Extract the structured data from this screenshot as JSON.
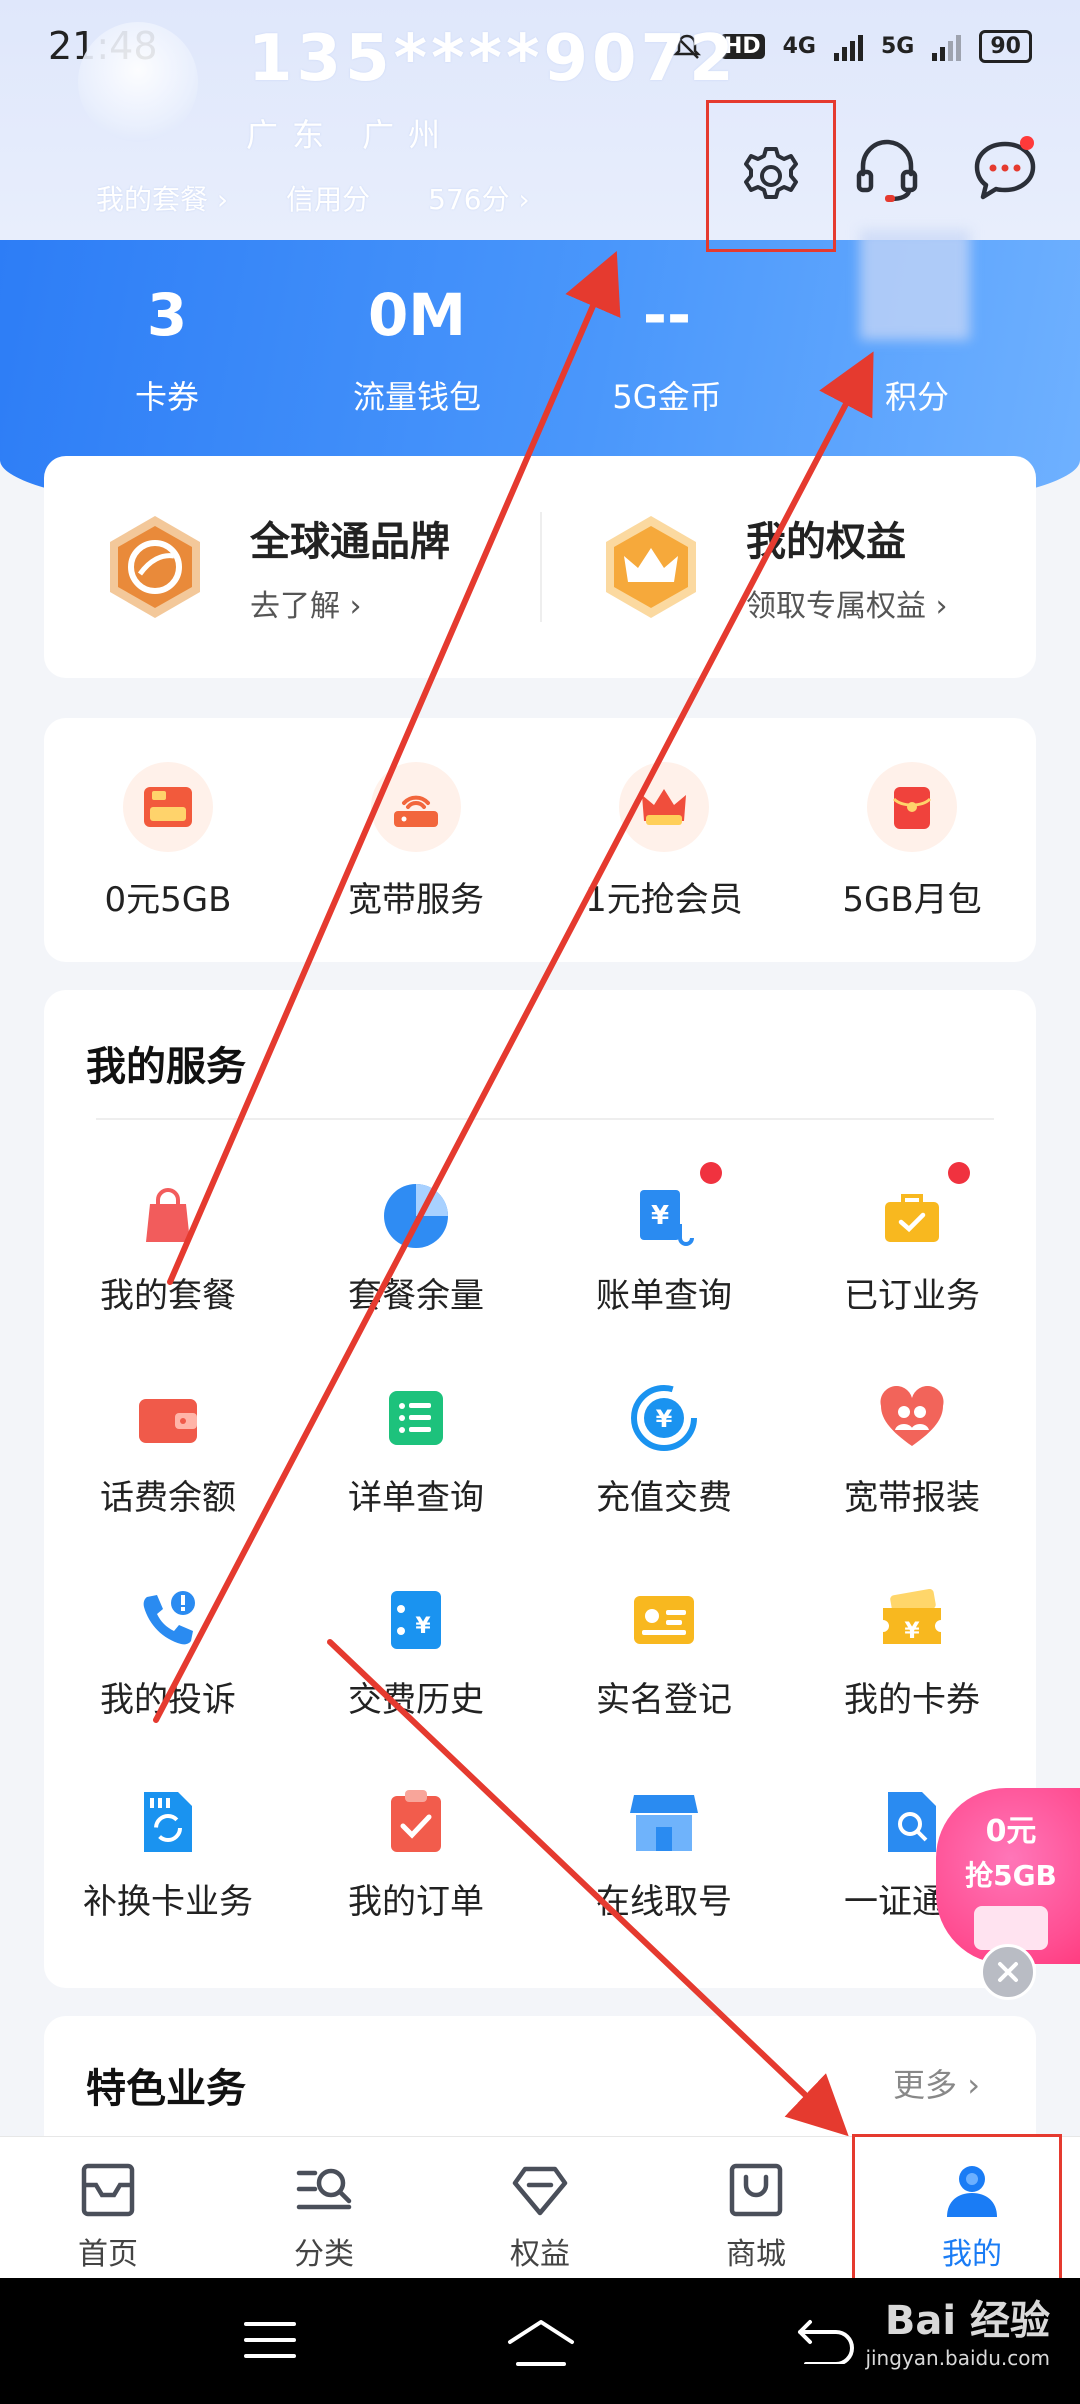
{
  "status_bar": {
    "time": "21:48",
    "network_labels": [
      "HD",
      "4G",
      "5G"
    ],
    "battery": "90"
  },
  "profile": {
    "phone": "135****9072",
    "region": "广东 广州",
    "links": [
      {
        "label": "我的套餐 ›"
      },
      {
        "label": "信用分"
      },
      {
        "label": "576分 ›"
      }
    ]
  },
  "stats": [
    {
      "value": "3",
      "label": "卡券"
    },
    {
      "value": "0M",
      "label": "流量钱包"
    },
    {
      "value": "--",
      "label": "5G金币"
    },
    {
      "value": "",
      "label": "积分"
    }
  ],
  "brand": [
    {
      "title": "全球通品牌",
      "subtitle": "去了解 ›",
      "icon": "globe-brand-icon"
    },
    {
      "title": "我的权益",
      "subtitle": "领取专属权益 ›",
      "icon": "crown-icon"
    }
  ],
  "quick": [
    {
      "label": "0元5GB",
      "icon": "5g-coupon-icon"
    },
    {
      "label": "宽带服务",
      "icon": "router-icon"
    },
    {
      "label": "1元抢会员",
      "icon": "vip-crown-icon"
    },
    {
      "label": "5GB月包",
      "icon": "red-packet-icon"
    }
  ],
  "services": {
    "title": "我的服务",
    "items": [
      {
        "label": "我的套餐",
        "icon": "package-bag-icon",
        "dot": false
      },
      {
        "label": "套餐余量",
        "icon": "pie-chart-icon",
        "dot": false
      },
      {
        "label": "账单查询",
        "icon": "bill-icon",
        "dot": true
      },
      {
        "label": "已订业务",
        "icon": "briefcase-icon",
        "dot": true
      },
      {
        "label": "话费余额",
        "icon": "wallet-icon",
        "dot": false
      },
      {
        "label": "详单查询",
        "icon": "list-icon",
        "dot": false
      },
      {
        "label": "充值交费",
        "icon": "yuan-circle-icon",
        "dot": false
      },
      {
        "label": "宽带报装",
        "icon": "heart-people-icon",
        "dot": false
      },
      {
        "label": "我的投诉",
        "icon": "phone-alert-icon",
        "dot": false
      },
      {
        "label": "交费历史",
        "icon": "payment-history-icon",
        "dot": false
      },
      {
        "label": "实名登记",
        "icon": "id-card-icon",
        "dot": false
      },
      {
        "label": "我的卡券",
        "icon": "coupon-icon",
        "dot": false
      },
      {
        "label": "补换卡业务",
        "icon": "sim-card-icon",
        "dot": false
      },
      {
        "label": "我的订单",
        "icon": "order-clipboard-icon",
        "dot": false
      },
      {
        "label": "在线取号",
        "icon": "store-icon",
        "dot": false
      },
      {
        "label": "一证通查",
        "icon": "id-search-icon",
        "dot": false
      }
    ]
  },
  "features": {
    "title": "特色业务",
    "more": "更多 ›"
  },
  "promo": {
    "line1": "0元",
    "line2": "抢5GB"
  },
  "tabs": [
    {
      "label": "首页",
      "icon": "home-icon",
      "active": false
    },
    {
      "label": "分类",
      "icon": "category-search-icon",
      "active": false
    },
    {
      "label": "权益",
      "icon": "diamond-icon",
      "active": false
    },
    {
      "label": "商城",
      "icon": "shopping-bag-icon",
      "active": false
    },
    {
      "label": "我的",
      "icon": "user-icon",
      "active": true
    }
  ],
  "watermark": {
    "main": "Bai 经验",
    "sub": "jingyan.baidu.com"
  },
  "colors": {
    "primary": "#1a7cf5",
    "annotation_red": "#e53a2f",
    "dot_red": "#f0323f"
  }
}
